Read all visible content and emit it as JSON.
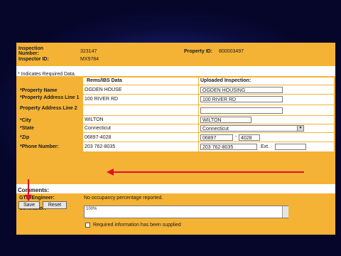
{
  "header": {
    "inspection_number_label": "Inspection Number:",
    "inspection_number_value": "323147",
    "inspector_id_label": "Inspector ID:",
    "inspector_id_value": "MX9784",
    "property_id_label": "Property ID:",
    "property_id_value": "800003497"
  },
  "required_note": "* Indicates Required Data.",
  "table": {
    "col_rems": "Rems/IBS Data",
    "col_uploaded": "Uploaded Inspection:",
    "rows": [
      {
        "label": "*Property Name",
        "rems": "OGDEN HOUSE",
        "uploaded": "OGDEN HOUSING"
      },
      {
        "label": "*Property Address Line 1",
        "rems": "100 RIVER RD",
        "uploaded": "100 RIVER RD"
      },
      {
        "label": "Property Address Line 2",
        "rems": "",
        "uploaded": ""
      },
      {
        "label": "*City",
        "rems": "WILTON",
        "uploaded": "WILTON"
      },
      {
        "label": "*State",
        "rems": "Connecticut",
        "uploaded": "Connecticut"
      },
      {
        "label": "*Zip",
        "rems": "06897-4028",
        "uploaded_zip": "06897",
        "uploaded_zip4": "4028",
        "dash": "-"
      },
      {
        "label": "*Phone Number:",
        "rems": "203 762-8035",
        "uploaded": "203 762-8035",
        "ext_label": "Ext.",
        "ext_value": ""
      }
    ]
  },
  "comments": {
    "title": "Comments:",
    "gtm_label": "GTM/Engineer:",
    "gtm_value": "No occupancy percentage reported.",
    "contractor_label": "Contractor:",
    "contractor_value": "100%",
    "checkbox_label": "Required information has been supplied"
  },
  "buttons": {
    "save": "Save",
    "reset": "Reset"
  },
  "colors": {
    "form_bg": "#f4b335",
    "annotation_arrow": "#e0102a"
  }
}
